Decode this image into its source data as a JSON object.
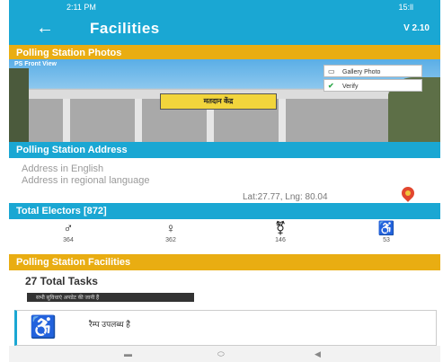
{
  "status": {
    "time": "2:11 PM",
    "signal": "15:ll"
  },
  "appbar": {
    "back": "←",
    "title": "Facilities",
    "version": "V 2.10"
  },
  "photos": {
    "header": "Polling Station Photos",
    "label": "PS Front View",
    "signboard": "मतदान केंद्र",
    "chip_gallery": "Gallery Photo",
    "chip_verify": "Verify"
  },
  "address": {
    "header": "Polling Station Address",
    "english": "Address in English",
    "regional": "Address in regional language",
    "latlng": "Lat:27.77, Lng: 80.04"
  },
  "voters": {
    "header": "Total Electors [872]",
    "items": [
      {
        "icon": "male-voter-icon",
        "glyph": "♂",
        "count": "364"
      },
      {
        "icon": "female-voter-icon",
        "glyph": "♀",
        "count": "362"
      },
      {
        "icon": "third-gender-icon",
        "glyph": "⚧",
        "count": "146"
      },
      {
        "icon": "wheelchair-icon",
        "glyph": "♿",
        "count": "53"
      }
    ]
  },
  "facilities": {
    "header": "Polling Station Facilities",
    "tasks": "27 Total Tasks",
    "bar_text": "सभी सुविधाएं अपडेट की जानी हैं",
    "card_text": "रैम्प उपलब्ध है"
  },
  "nav": {
    "menu": "▬",
    "home": "⬭",
    "back": "◀"
  }
}
